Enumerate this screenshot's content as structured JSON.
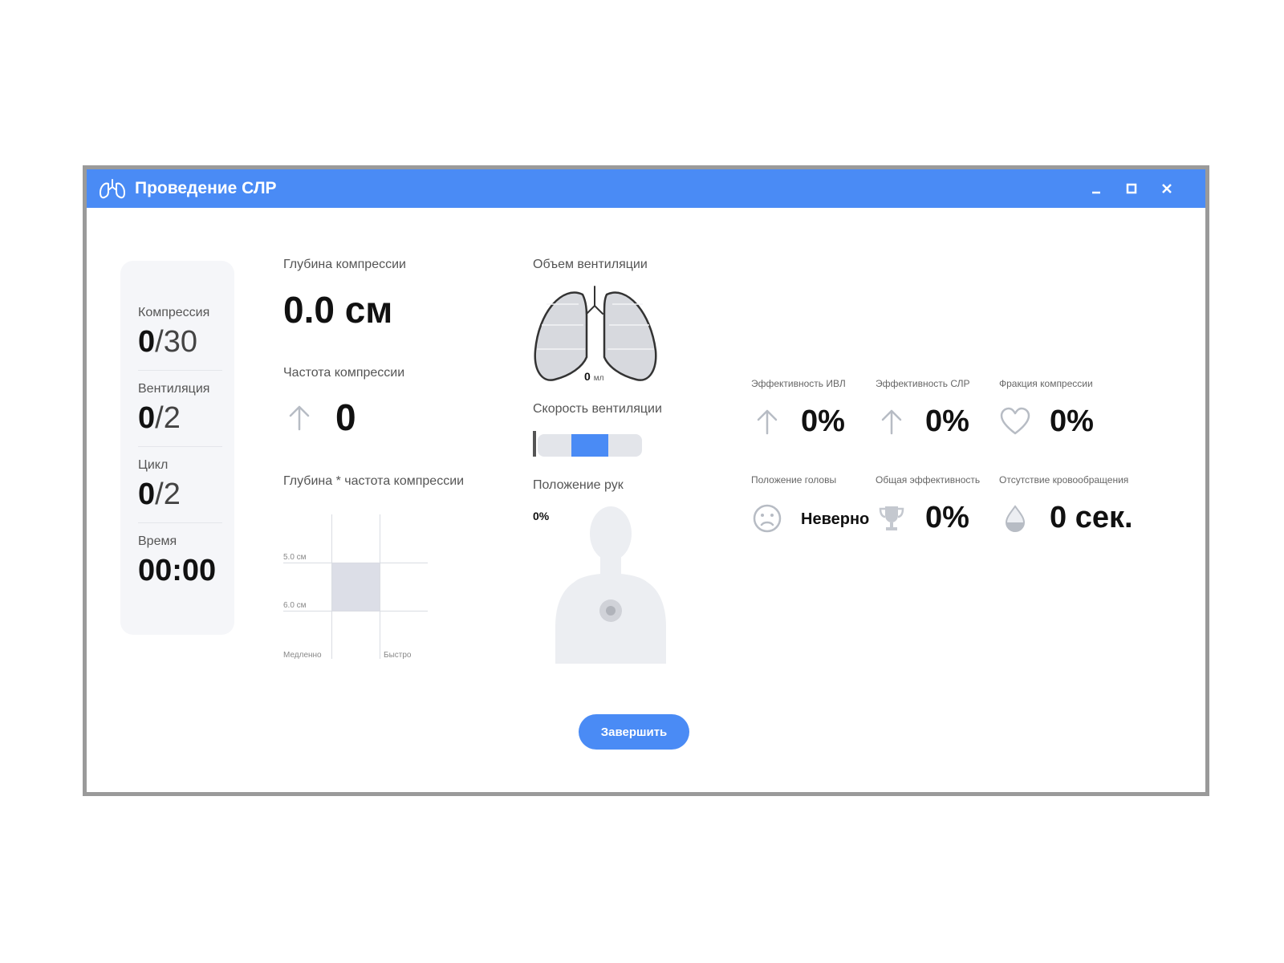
{
  "window": {
    "title": "Проведение СЛР",
    "controls": {
      "minimize": "minimize",
      "maximize": "maximize",
      "close": "close"
    }
  },
  "stats": {
    "compression": {
      "label": "Компрессия",
      "current": "0",
      "total": "/30"
    },
    "ventilation": {
      "label": "Вентиляция",
      "current": "0",
      "total": "/2"
    },
    "cycle": {
      "label": "Цикл",
      "current": "0",
      "total": "/2"
    },
    "time": {
      "label": "Время",
      "value": "00:00"
    }
  },
  "compression_depth": {
    "label": "Глубина компрессии",
    "value": "0.0 см"
  },
  "compression_rate": {
    "label": "Частота компрессии",
    "value": "0"
  },
  "depth_rate_chart": {
    "label": "Глубина * частота компрессии",
    "y_labels": [
      "5.0 см",
      "6.0 см"
    ],
    "x_labels": [
      "Медленно",
      "Быстро"
    ]
  },
  "ventilation_volume": {
    "label": "Объем вентиляции",
    "value": "0",
    "unit": "мл"
  },
  "ventilation_speed": {
    "label": "Скорость вентиляции",
    "level": 0.5
  },
  "hand_position": {
    "label": "Положение рук",
    "value": "0%"
  },
  "metrics": {
    "ivl_efficiency": {
      "label": "Эффективность ИВЛ",
      "value": "0%",
      "icon": "arrow-up-icon"
    },
    "cpr_efficiency": {
      "label": "Эффективность СЛР",
      "value": "0%",
      "icon": "arrow-up-icon"
    },
    "compression_fraction": {
      "label": "Фракция компрессии",
      "value": "0%",
      "icon": "heart-icon"
    },
    "head_position": {
      "label": "Положение головы",
      "value": "Неверно",
      "icon": "sad-face-icon"
    },
    "overall_efficiency": {
      "label": "Общая эффективность",
      "value": "0%",
      "icon": "trophy-icon"
    },
    "no_circulation": {
      "label": "Отсутствие кровообращения",
      "value": "0 сек.",
      "icon": "drop-icon"
    }
  },
  "colors": {
    "accent": "#4a8bf5",
    "panel_bg": "#f5f6f9",
    "border": "#9a9a9a"
  },
  "finish_button": {
    "label": "Завершить"
  }
}
